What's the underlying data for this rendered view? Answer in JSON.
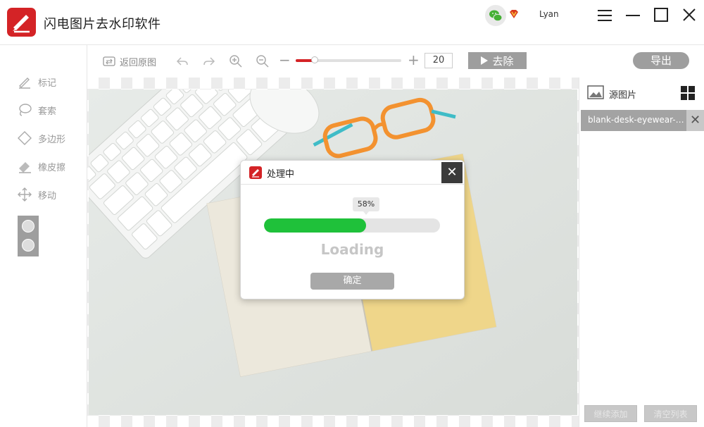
{
  "app": {
    "title": "闪电图片去水印软件",
    "username": "Lyan"
  },
  "window": {
    "menu_icon": "hamburger-icon",
    "minimize_icon": "minimize-icon",
    "maximize_icon": "maximize-icon",
    "close_icon": "close-icon"
  },
  "toolbar": {
    "restore_label": "返回原图",
    "zoom_value": "20",
    "zoom_minus": "−",
    "zoom_plus": "+",
    "zoom_slider_fraction": 0.18,
    "remove_label": "去除",
    "export_label": "导出"
  },
  "sidebar": {
    "tools": [
      {
        "label": "标记",
        "icon": "pen-icon"
      },
      {
        "label": "套索",
        "icon": "lasso-icon"
      },
      {
        "label": "多边形",
        "icon": "polygon-icon"
      },
      {
        "label": "橡皮擦",
        "icon": "eraser-icon"
      },
      {
        "label": "移动",
        "icon": "move-icon"
      }
    ]
  },
  "right_panel": {
    "title": "源图片",
    "file_name": "blank-desk-eyewear-3...",
    "file_close": "✕",
    "continue_add_label": "继续添加",
    "clear_list_label": "清空列表"
  },
  "dialog": {
    "title": "处理中",
    "close": "✕",
    "percent_label": "58%",
    "progress_fraction": 0.58,
    "status": "Loading",
    "confirm_label": "确定"
  },
  "colors": {
    "brand": "#d42326",
    "progress": "#1fc13a",
    "button_gray": "#9e9e9e"
  }
}
